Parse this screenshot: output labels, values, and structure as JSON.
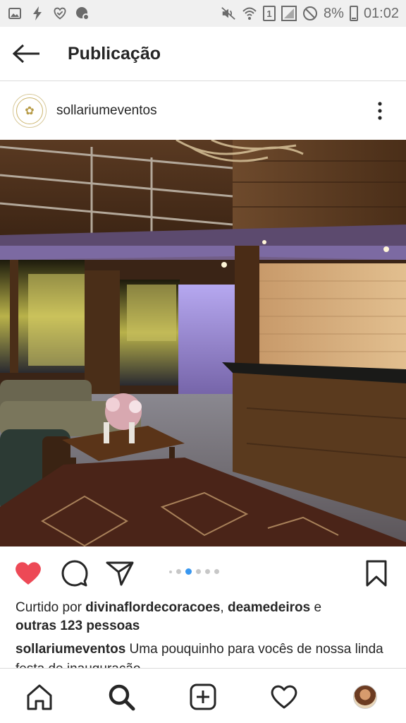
{
  "status_bar": {
    "left_icons": [
      "image-icon",
      "lightning-icon",
      "heart-check-icon",
      "chat-settings-icon"
    ],
    "right_icons": [
      "mute-icon",
      "wifi-icon",
      "sim-icon",
      "signal-icon",
      "do-not-disturb-icon",
      "battery-icon"
    ],
    "sim_label": "1",
    "battery_percent": "8%",
    "time": "01:02"
  },
  "header": {
    "back_icon": "arrow-left-icon",
    "title": "Publicação"
  },
  "post": {
    "username": "sollariumeventos",
    "more_icon": "vertical-dots-icon",
    "image_subject": "wooden interior lounge with sofa, coffee table, bar counter and mezzanine",
    "carousel": {
      "count": 6,
      "active_index": 2
    },
    "likes": {
      "prefix": "Curtido por ",
      "user1": "divinaflordecoracoes",
      "sep": ", ",
      "user2": "deamedeiros",
      "and": " e",
      "others": "outras 123 pessoas"
    },
    "caption": {
      "user": "sollariumeventos",
      "text": " Uma pouquinho para vocês de nossa linda festa de inauguração..."
    }
  },
  "actions": {
    "like_icon": "heart-filled-icon",
    "comment_icon": "comment-icon",
    "share_icon": "paper-plane-icon",
    "save_icon": "bookmark-icon"
  },
  "bottom_nav": {
    "items": [
      "home-icon",
      "search-icon",
      "add-post-icon",
      "activity-icon",
      "profile-icon"
    ]
  },
  "colors": {
    "like_red": "#ed4956",
    "carousel_active": "#3897f0",
    "text": "#262626",
    "divider": "#dbdbdb"
  }
}
